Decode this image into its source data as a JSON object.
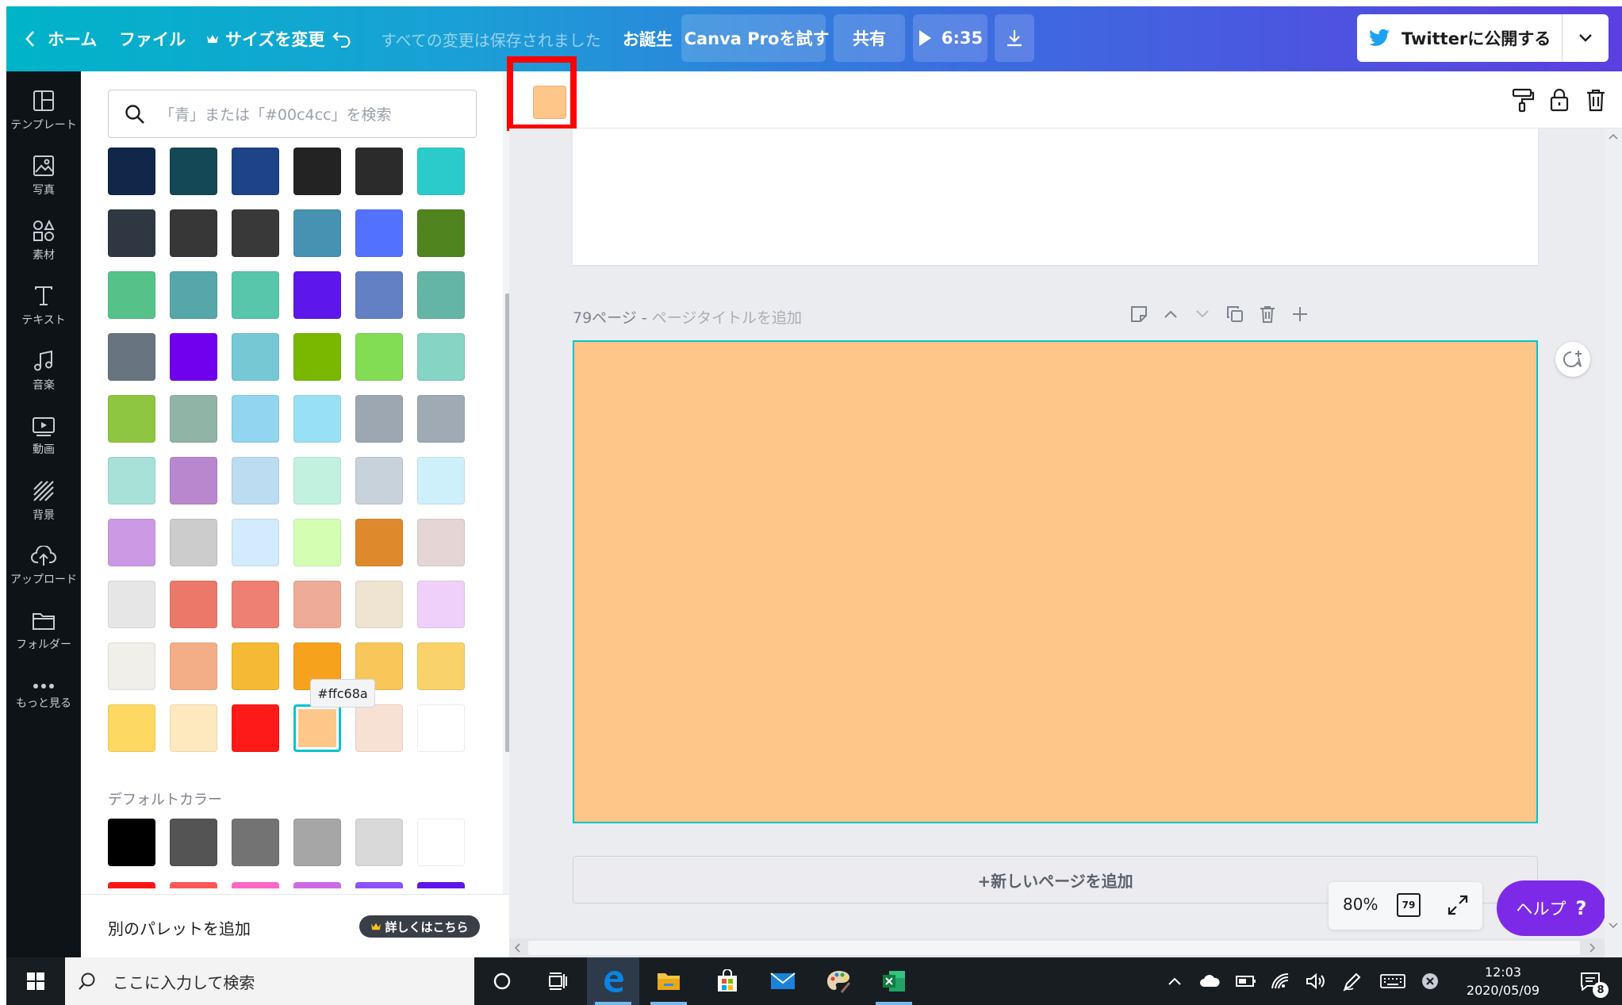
{
  "topbar": {
    "home_label": "ホーム",
    "file_label": "ファイル",
    "resize_label": "サイズを変更",
    "save_status": "すべての変更は保存されました",
    "doc_title": "お誕生",
    "pro_label": "Canva Proを試す",
    "share_label": "共有",
    "present_time": "6:35",
    "publish_label": "Twitterに公開する"
  },
  "rail": {
    "items": [
      {
        "label": "テンプレート",
        "icon": "template-icon"
      },
      {
        "label": "写真",
        "icon": "photo-icon"
      },
      {
        "label": "素材",
        "icon": "elements-icon"
      },
      {
        "label": "テキスト",
        "icon": "text-icon"
      },
      {
        "label": "音楽",
        "icon": "music-icon"
      },
      {
        "label": "動画",
        "icon": "video-icon"
      },
      {
        "label": "背景",
        "icon": "background-icon"
      },
      {
        "label": "アップロード",
        "icon": "upload-icon"
      },
      {
        "label": "フォルダー",
        "icon": "folder-icon"
      },
      {
        "label": "もっと見る",
        "icon": "more-icon"
      }
    ]
  },
  "color_panel": {
    "search_placeholder": "「青」または「#00c4cc」を検索",
    "swatches": [
      "#10274a",
      "#154856",
      "#1e4487",
      "#232323",
      "#2b2b2b",
      "#2ccbcb",
      "#2f3743",
      "#373737",
      "#393939",
      "#4592b2",
      "#5271ff",
      "#4f841e",
      "#55c389",
      "#55a7aa",
      "#58c6ab",
      "#5e17eb",
      "#6480c4",
      "#65b5a6",
      "#68747f",
      "#7000ee",
      "#76c9d4",
      "#7ab800",
      "#82dd55",
      "#86d4c4",
      "#8fc641",
      "#90b4a6",
      "#92d5f0",
      "#98e0f4",
      "#9da7b2",
      "#a0aab5",
      "#a8e1d7",
      "#b987ce",
      "#bcdcf2",
      "#c2f2df",
      "#c8d2da",
      "#cef0fb",
      "#cc99e5",
      "#cccccc",
      "#d2ebfd",
      "#d4ffb2",
      "#de8a2c",
      "#e6d5d5",
      "#e6e6e6",
      "#ec7869",
      "#ed8072",
      "#eeab98",
      "#efe4d2",
      "#efd0fb",
      "#f0efe9",
      "#f3ae88",
      "#f4ba34",
      "#f7a21c",
      "#f8c659",
      "#fad26a",
      "#fdd862",
      "#fde9bd",
      "#ff1a1a",
      "#ffc68a",
      "#f7e0d4",
      "#ffffff"
    ],
    "selected_color": "#ffc68a",
    "tooltip": "#ffc68a",
    "default_title": "デフォルトカラー",
    "default_colors": [
      "#000000",
      "#545454",
      "#737373",
      "#a6a6a6",
      "#d9d9d9",
      "#ffffff"
    ],
    "default_peek": [
      "#ff1616",
      "#ff5757",
      "#ff66c4",
      "#cb6ce6",
      "#8c52ff",
      "#5e17eb"
    ],
    "footer_label": "別のパレットを追加",
    "footer_pro": "詳しくはこちら"
  },
  "editor": {
    "selected_fill": "#ffc68a",
    "page_label": "79ページ - ",
    "page_title_placeholder": "ページタイトルを追加",
    "page_fill": "#ffc68a",
    "add_page_label": "+新しいページを追加",
    "zoom": "80%",
    "page_count": "79",
    "help_label": "ヘルプ",
    "help_mark": "?"
  },
  "taskbar": {
    "search_placeholder": "ここに入力して検索",
    "time": "12:03",
    "date": "2020/05/09",
    "notification_count": "8"
  },
  "colors": {
    "brand_teal": "#00c4cc",
    "highlight_red": "#ff0000",
    "help_purple": "#7d2ae8"
  }
}
